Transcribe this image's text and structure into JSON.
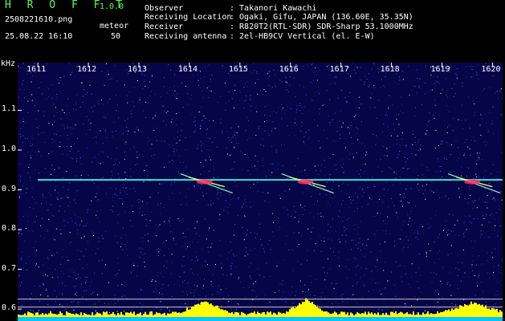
{
  "header": {
    "app_title": "H R O F F T",
    "app_version": "1.0.0",
    "file_name": "2508221610.png",
    "mode": "meteor",
    "timestamp": "25.08.22 16:10",
    "count": "50",
    "info": [
      {
        "label": "Observer",
        "value": ": Takanori Kawachi"
      },
      {
        "label": "Receiving Location",
        "value": ": Ogaki, Gifu, JAPAN (136.60E, 35.35N)"
      },
      {
        "label": "Receiver",
        "value": ": R820T2(RTL-SDR) SDR-Sharp 53.1000MHz"
      },
      {
        "label": "Receiving antenna",
        "value": ": 2el-HB9CV Vertical (el. E-W)"
      }
    ]
  },
  "chart_data": {
    "type": "heatmap",
    "ylabel": "kHz",
    "x_ticks": [
      "1611",
      "1612",
      "1613",
      "1614",
      "1615",
      "1616",
      "1617",
      "1618",
      "1619",
      "1620"
    ],
    "y_ticks": [
      "1.1",
      "1.0",
      "0.9",
      "0.8",
      "0.7",
      "0.6"
    ],
    "xlim": [
      1610.6,
      1620.2
    ],
    "ylim": [
      0.57,
      1.22
    ],
    "carrier_khz": 0.925,
    "carrier_x_range": [
      1611.0,
      1620.2
    ],
    "meteor_echoes": [
      {
        "x_center": 1614.3,
        "y_khz": 0.92
      },
      {
        "x_center": 1616.3,
        "y_khz": 0.92
      },
      {
        "x_center": 1619.6,
        "y_khz": 0.92
      }
    ],
    "colors": {
      "background": "#050548",
      "noise": "#4a6cff",
      "carrier": "#40e0d0",
      "echo_core": "#ff3366",
      "power_bar": "#ffff00",
      "power_base": "#00c8ff"
    }
  }
}
